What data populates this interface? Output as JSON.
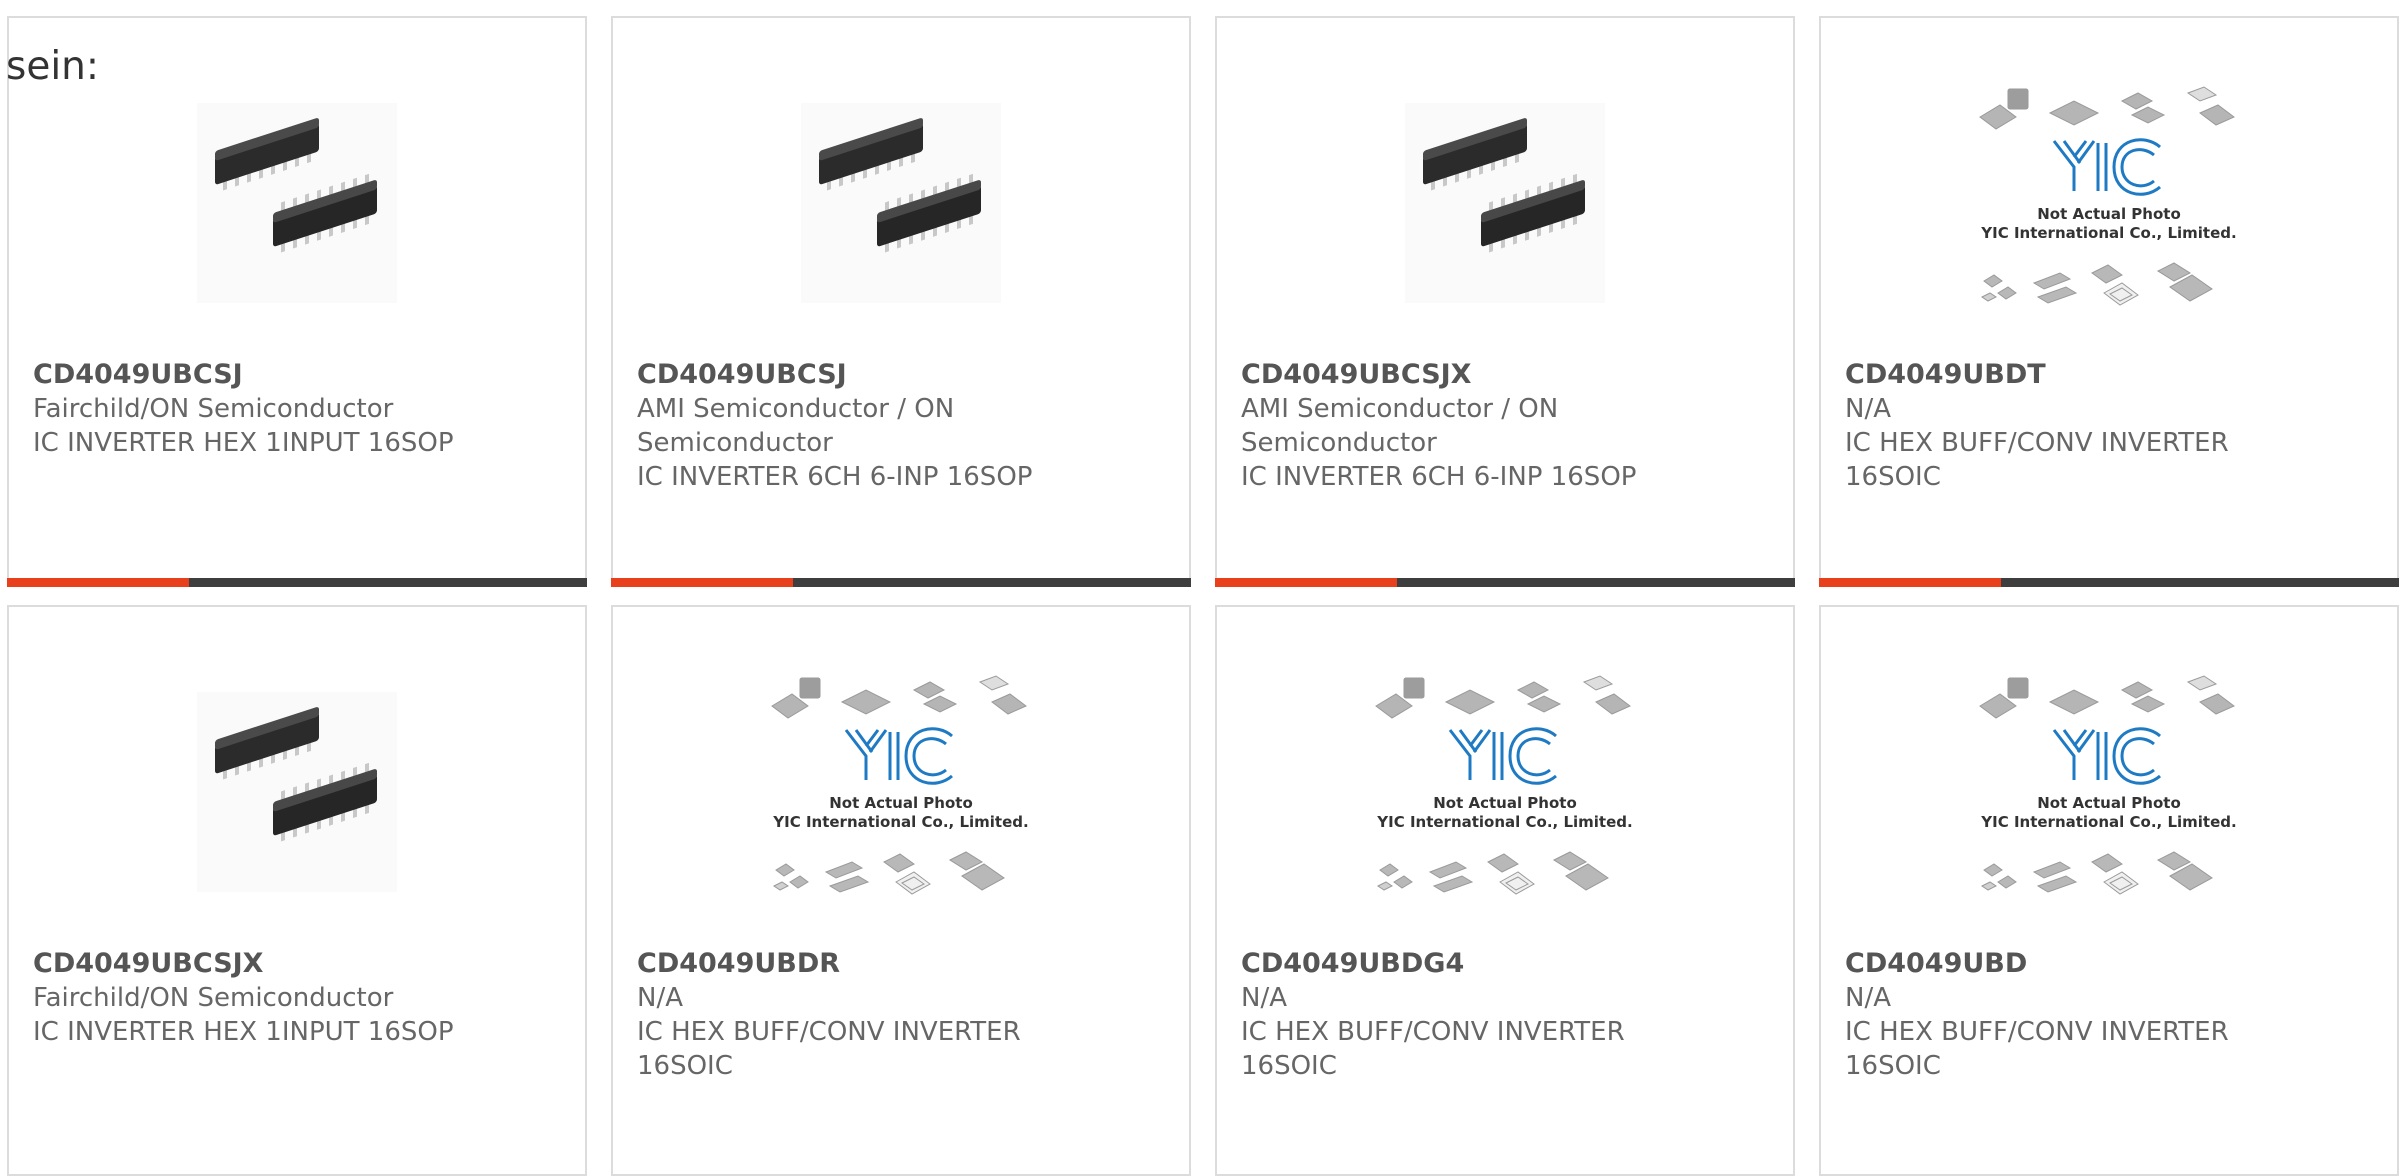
{
  "prefix_text": "sein:",
  "placeholder": {
    "line1": "Not Actual Photo",
    "line2": "YIC International Co., Limited.",
    "logo": "YIC"
  },
  "colors": {
    "accent": "#e8401c",
    "bar": "#3e3e3e",
    "border": "#dcdcdc",
    "text": "#666666"
  },
  "products": [
    {
      "part": "CD4049UBCSJ",
      "manufacturer": "Fairchild/ON Semiconductor",
      "manufacturer2": "",
      "desc": "IC INVERTER HEX 1INPUT 16SOP",
      "desc2": "",
      "image": "chip-photo",
      "show_bar": true
    },
    {
      "part": "CD4049UBCSJ",
      "manufacturer": "AMI Semiconductor / ON",
      "manufacturer2": "Semiconductor",
      "desc": "IC INVERTER 6CH 6-INP 16SOP",
      "desc2": "",
      "image": "chip-photo",
      "show_bar": true
    },
    {
      "part": "CD4049UBCSJX",
      "manufacturer": "AMI Semiconductor / ON",
      "manufacturer2": "Semiconductor",
      "desc": "IC INVERTER 6CH 6-INP 16SOP",
      "desc2": "",
      "image": "chip-photo",
      "show_bar": true
    },
    {
      "part": "CD4049UBDT",
      "manufacturer": "N/A",
      "manufacturer2": "",
      "desc": "IC HEX BUFF/CONV INVERTER",
      "desc2": "16SOIC",
      "image": "placeholder",
      "show_bar": true
    },
    {
      "part": "CD4049UBCSJX",
      "manufacturer": "Fairchild/ON Semiconductor",
      "manufacturer2": "",
      "desc": "IC INVERTER HEX 1INPUT 16SOP",
      "desc2": "",
      "image": "chip-photo",
      "show_bar": false
    },
    {
      "part": "CD4049UBDR",
      "manufacturer": "N/A",
      "manufacturer2": "",
      "desc": "IC HEX BUFF/CONV INVERTER",
      "desc2": "16SOIC",
      "image": "placeholder",
      "show_bar": false
    },
    {
      "part": "CD4049UBDG4",
      "manufacturer": "N/A",
      "manufacturer2": "",
      "desc": "IC HEX BUFF/CONV INVERTER",
      "desc2": "16SOIC",
      "image": "placeholder",
      "show_bar": false
    },
    {
      "part": "CD4049UBD",
      "manufacturer": "N/A",
      "manufacturer2": "",
      "desc": "IC HEX BUFF/CONV INVERTER",
      "desc2": "16SOIC",
      "image": "placeholder",
      "show_bar": false
    }
  ]
}
